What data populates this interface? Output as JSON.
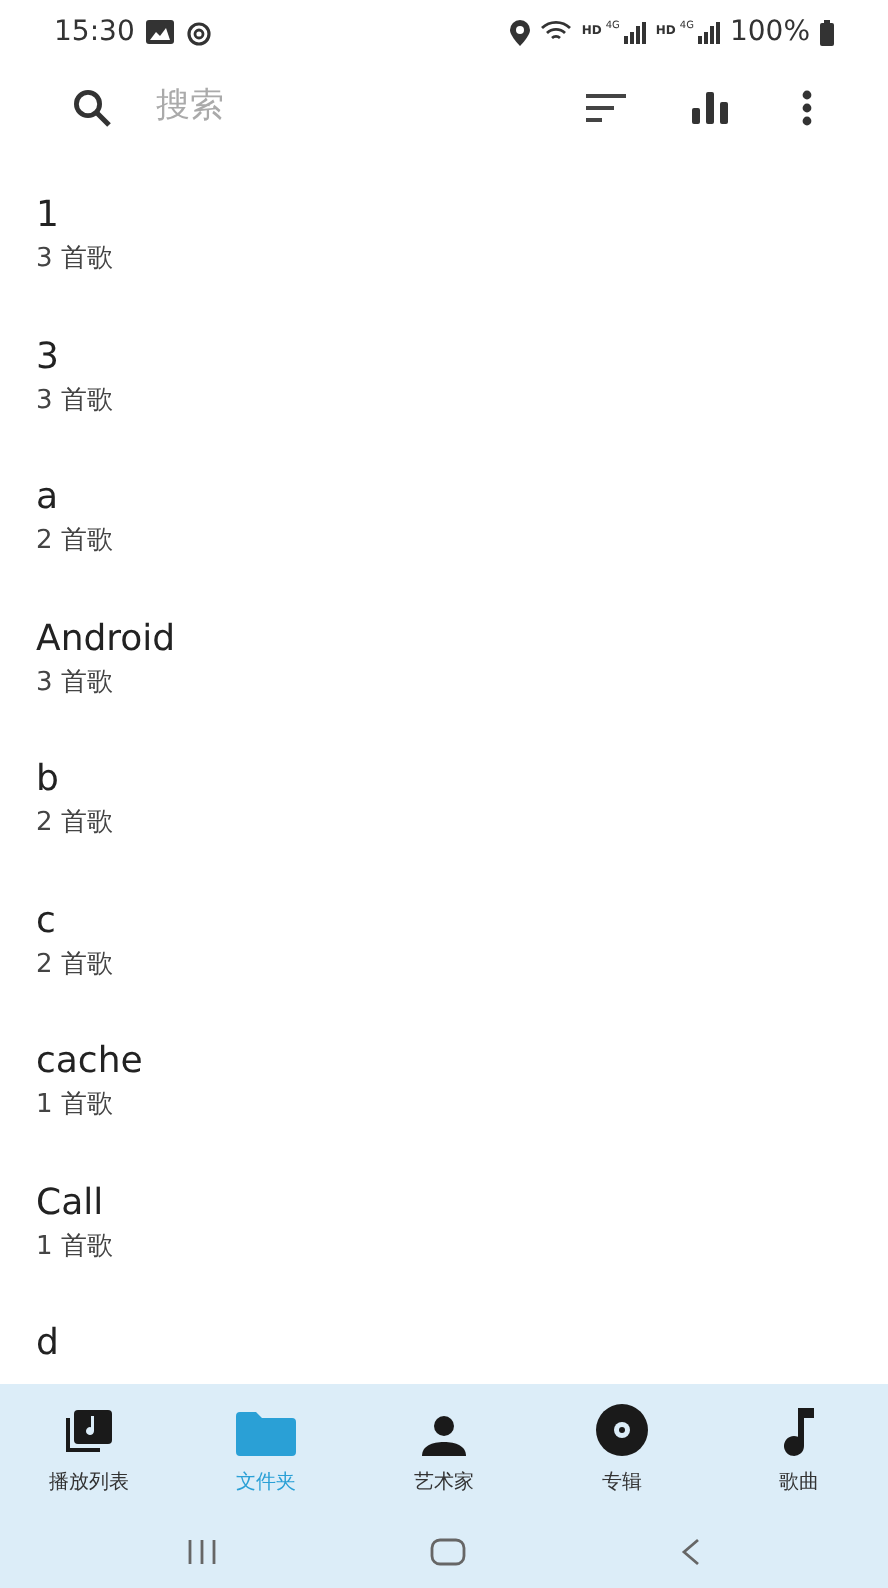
{
  "status_bar": {
    "time": "15:30",
    "sims": [
      {
        "hd": "HD",
        "network": "4G"
      },
      {
        "hd": "HD",
        "network": "4G"
      }
    ],
    "battery": "100%"
  },
  "search": {
    "placeholder": "搜索"
  },
  "folders": [
    {
      "name": "1",
      "count": "3 首歌"
    },
    {
      "name": "3",
      "count": "3 首歌"
    },
    {
      "name": "a",
      "count": "2 首歌"
    },
    {
      "name": "Android",
      "count": "3 首歌"
    },
    {
      "name": "b",
      "count": "2 首歌"
    },
    {
      "name": "c",
      "count": "2 首歌"
    },
    {
      "name": "cache",
      "count": "1 首歌"
    },
    {
      "name": "Call",
      "count": "1 首歌"
    },
    {
      "name": "d"
    }
  ],
  "bottom_nav": [
    {
      "kind": "playlist",
      "label": "播放列表",
      "selected": false
    },
    {
      "kind": "folder",
      "label": "文件夹",
      "selected": true
    },
    {
      "kind": "artist",
      "label": "艺术家",
      "selected": false
    },
    {
      "kind": "album",
      "label": "专辑",
      "selected": false
    },
    {
      "kind": "song",
      "label": "歌曲",
      "selected": false
    }
  ]
}
